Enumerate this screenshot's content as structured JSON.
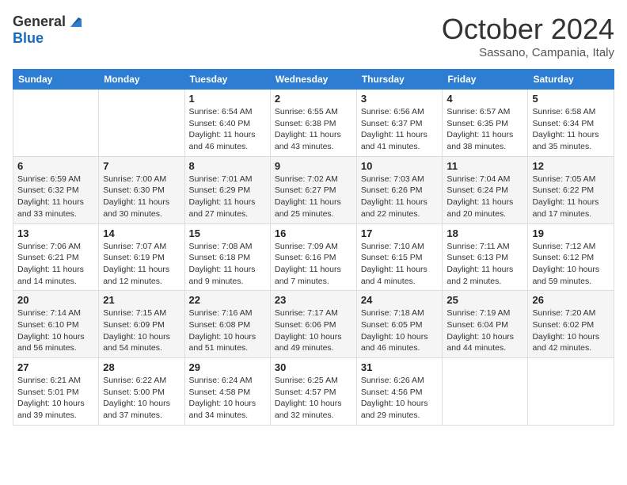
{
  "header": {
    "logo": {
      "general": "General",
      "blue": "Blue"
    },
    "title": "October 2024",
    "subtitle": "Sassano, Campania, Italy"
  },
  "weekdays": [
    "Sunday",
    "Monday",
    "Tuesday",
    "Wednesday",
    "Thursday",
    "Friday",
    "Saturday"
  ],
  "weeks": [
    [
      null,
      null,
      {
        "day": "1",
        "sunrise": "Sunrise: 6:54 AM",
        "sunset": "Sunset: 6:40 PM",
        "daylight": "Daylight: 11 hours and 46 minutes."
      },
      {
        "day": "2",
        "sunrise": "Sunrise: 6:55 AM",
        "sunset": "Sunset: 6:38 PM",
        "daylight": "Daylight: 11 hours and 43 minutes."
      },
      {
        "day": "3",
        "sunrise": "Sunrise: 6:56 AM",
        "sunset": "Sunset: 6:37 PM",
        "daylight": "Daylight: 11 hours and 41 minutes."
      },
      {
        "day": "4",
        "sunrise": "Sunrise: 6:57 AM",
        "sunset": "Sunset: 6:35 PM",
        "daylight": "Daylight: 11 hours and 38 minutes."
      },
      {
        "day": "5",
        "sunrise": "Sunrise: 6:58 AM",
        "sunset": "Sunset: 6:34 PM",
        "daylight": "Daylight: 11 hours and 35 minutes."
      }
    ],
    [
      {
        "day": "6",
        "sunrise": "Sunrise: 6:59 AM",
        "sunset": "Sunset: 6:32 PM",
        "daylight": "Daylight: 11 hours and 33 minutes."
      },
      {
        "day": "7",
        "sunrise": "Sunrise: 7:00 AM",
        "sunset": "Sunset: 6:30 PM",
        "daylight": "Daylight: 11 hours and 30 minutes."
      },
      {
        "day": "8",
        "sunrise": "Sunrise: 7:01 AM",
        "sunset": "Sunset: 6:29 PM",
        "daylight": "Daylight: 11 hours and 27 minutes."
      },
      {
        "day": "9",
        "sunrise": "Sunrise: 7:02 AM",
        "sunset": "Sunset: 6:27 PM",
        "daylight": "Daylight: 11 hours and 25 minutes."
      },
      {
        "day": "10",
        "sunrise": "Sunrise: 7:03 AM",
        "sunset": "Sunset: 6:26 PM",
        "daylight": "Daylight: 11 hours and 22 minutes."
      },
      {
        "day": "11",
        "sunrise": "Sunrise: 7:04 AM",
        "sunset": "Sunset: 6:24 PM",
        "daylight": "Daylight: 11 hours and 20 minutes."
      },
      {
        "day": "12",
        "sunrise": "Sunrise: 7:05 AM",
        "sunset": "Sunset: 6:22 PM",
        "daylight": "Daylight: 11 hours and 17 minutes."
      }
    ],
    [
      {
        "day": "13",
        "sunrise": "Sunrise: 7:06 AM",
        "sunset": "Sunset: 6:21 PM",
        "daylight": "Daylight: 11 hours and 14 minutes."
      },
      {
        "day": "14",
        "sunrise": "Sunrise: 7:07 AM",
        "sunset": "Sunset: 6:19 PM",
        "daylight": "Daylight: 11 hours and 12 minutes."
      },
      {
        "day": "15",
        "sunrise": "Sunrise: 7:08 AM",
        "sunset": "Sunset: 6:18 PM",
        "daylight": "Daylight: 11 hours and 9 minutes."
      },
      {
        "day": "16",
        "sunrise": "Sunrise: 7:09 AM",
        "sunset": "Sunset: 6:16 PM",
        "daylight": "Daylight: 11 hours and 7 minutes."
      },
      {
        "day": "17",
        "sunrise": "Sunrise: 7:10 AM",
        "sunset": "Sunset: 6:15 PM",
        "daylight": "Daylight: 11 hours and 4 minutes."
      },
      {
        "day": "18",
        "sunrise": "Sunrise: 7:11 AM",
        "sunset": "Sunset: 6:13 PM",
        "daylight": "Daylight: 11 hours and 2 minutes."
      },
      {
        "day": "19",
        "sunrise": "Sunrise: 7:12 AM",
        "sunset": "Sunset: 6:12 PM",
        "daylight": "Daylight: 10 hours and 59 minutes."
      }
    ],
    [
      {
        "day": "20",
        "sunrise": "Sunrise: 7:14 AM",
        "sunset": "Sunset: 6:10 PM",
        "daylight": "Daylight: 10 hours and 56 minutes."
      },
      {
        "day": "21",
        "sunrise": "Sunrise: 7:15 AM",
        "sunset": "Sunset: 6:09 PM",
        "daylight": "Daylight: 10 hours and 54 minutes."
      },
      {
        "day": "22",
        "sunrise": "Sunrise: 7:16 AM",
        "sunset": "Sunset: 6:08 PM",
        "daylight": "Daylight: 10 hours and 51 minutes."
      },
      {
        "day": "23",
        "sunrise": "Sunrise: 7:17 AM",
        "sunset": "Sunset: 6:06 PM",
        "daylight": "Daylight: 10 hours and 49 minutes."
      },
      {
        "day": "24",
        "sunrise": "Sunrise: 7:18 AM",
        "sunset": "Sunset: 6:05 PM",
        "daylight": "Daylight: 10 hours and 46 minutes."
      },
      {
        "day": "25",
        "sunrise": "Sunrise: 7:19 AM",
        "sunset": "Sunset: 6:04 PM",
        "daylight": "Daylight: 10 hours and 44 minutes."
      },
      {
        "day": "26",
        "sunrise": "Sunrise: 7:20 AM",
        "sunset": "Sunset: 6:02 PM",
        "daylight": "Daylight: 10 hours and 42 minutes."
      }
    ],
    [
      {
        "day": "27",
        "sunrise": "Sunrise: 6:21 AM",
        "sunset": "Sunset: 5:01 PM",
        "daylight": "Daylight: 10 hours and 39 minutes."
      },
      {
        "day": "28",
        "sunrise": "Sunrise: 6:22 AM",
        "sunset": "Sunset: 5:00 PM",
        "daylight": "Daylight: 10 hours and 37 minutes."
      },
      {
        "day": "29",
        "sunrise": "Sunrise: 6:24 AM",
        "sunset": "Sunset: 4:58 PM",
        "daylight": "Daylight: 10 hours and 34 minutes."
      },
      {
        "day": "30",
        "sunrise": "Sunrise: 6:25 AM",
        "sunset": "Sunset: 4:57 PM",
        "daylight": "Daylight: 10 hours and 32 minutes."
      },
      {
        "day": "31",
        "sunrise": "Sunrise: 6:26 AM",
        "sunset": "Sunset: 4:56 PM",
        "daylight": "Daylight: 10 hours and 29 minutes."
      },
      null,
      null
    ]
  ]
}
